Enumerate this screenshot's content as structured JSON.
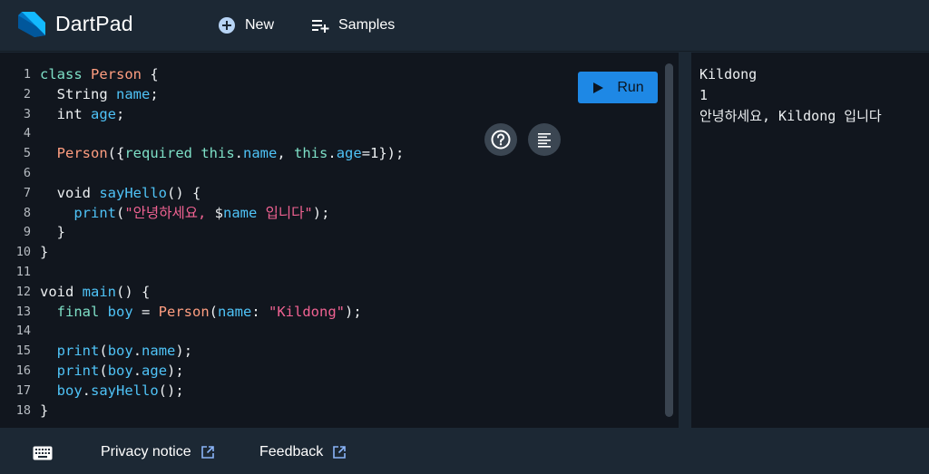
{
  "header": {
    "app_title": "DartPad",
    "new_label": "New",
    "samples_label": "Samples"
  },
  "editor": {
    "line_numbers": [
      "1",
      "2",
      "3",
      "4",
      "5",
      "6",
      "7",
      "8",
      "9",
      "10",
      "11",
      "12",
      "13",
      "14",
      "15",
      "16",
      "17",
      "18"
    ],
    "run_label": "Run"
  },
  "console": {
    "lines": [
      "Kildong",
      "1",
      "안녕하세요, Kildong 입니다"
    ]
  },
  "footer": {
    "privacy_label": "Privacy notice",
    "feedback_label": "Feedback"
  },
  "colors": {
    "accent": "#1e88e5",
    "background": "#1c2834",
    "editor_bg": "#11161e"
  }
}
